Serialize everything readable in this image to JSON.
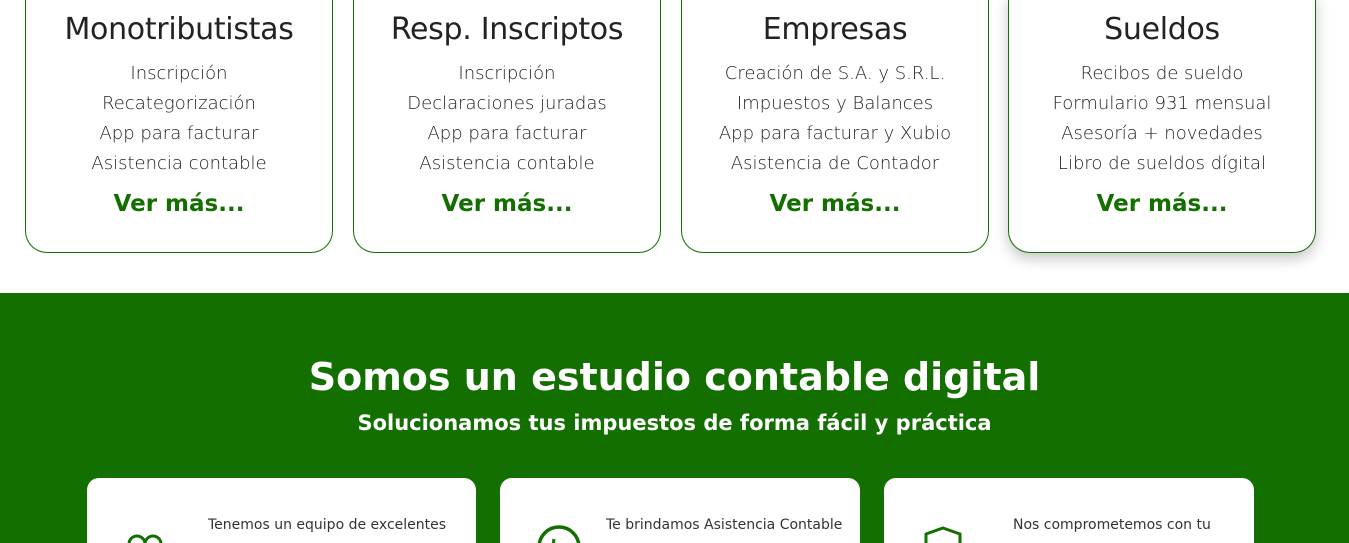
{
  "services": [
    {
      "title": "Monotributistas",
      "items": [
        "Inscripción",
        "Recategorización",
        "App para facturar",
        "Asistencia contable"
      ],
      "link": "Ver más..."
    },
    {
      "title": "Resp. Inscriptos",
      "items": [
        "Inscripción",
        "Declaraciones juradas",
        "App para facturar",
        "Asistencia contable"
      ],
      "link": "Ver más..."
    },
    {
      "title": "Empresas",
      "items": [
        "Creación de S.A. y S.R.L.",
        "Impuestos y Balances",
        "App para facturar y Xubio",
        "Asistencia de Contador"
      ],
      "link": "Ver más..."
    },
    {
      "title": "Sueldos",
      "items": [
        "Recibos de sueldo",
        "Formulario 931 mensual",
        "Asesoría + novedades",
        "Libro de sueldos dígital"
      ],
      "link": "Ver más..."
    }
  ],
  "about": {
    "heading": "Somos un estudio contable digital",
    "subheading": "Solucionamos tus impuestos de forma fácil y práctica"
  },
  "features": [
    {
      "icon": "team-icon",
      "text": "Tenemos un equipo de excelentes"
    },
    {
      "icon": "whatsapp-icon",
      "text": "Te brindamos Asistencia Contable"
    },
    {
      "icon": "shield-icon",
      "text": "Nos comprometemos con tu"
    }
  ],
  "colors": {
    "brand_green": "#137000",
    "text": "#222222",
    "background": "#ffffff"
  }
}
